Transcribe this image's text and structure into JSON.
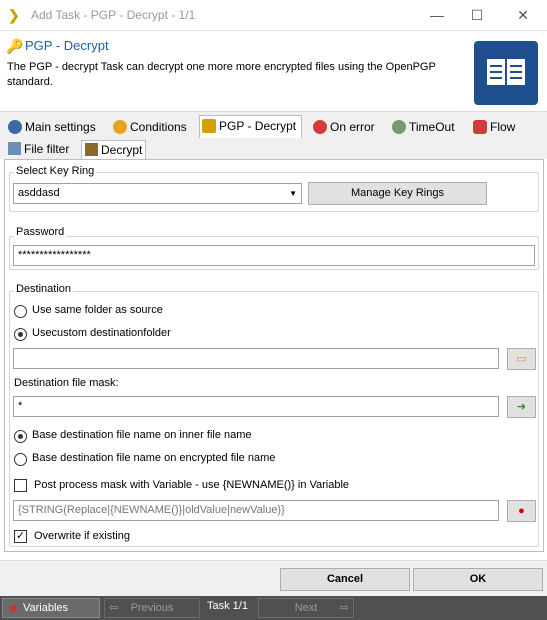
{
  "window": {
    "title": "Add Task - PGP - Decrypt - 1/1",
    "minimize": "—",
    "maximize": "☐",
    "close": "✕"
  },
  "header": {
    "title": "PGP - Decrypt",
    "description": "The PGP - decrypt Task can decrypt one more more encrypted files using the OpenPGP standard."
  },
  "tabs": [
    {
      "label": "Main settings",
      "icon": "gear-icon"
    },
    {
      "label": "Conditions",
      "icon": "conditions-icon"
    },
    {
      "label": "PGP - Decrypt",
      "icon": "key-icon"
    },
    {
      "label": "On error",
      "icon": "error-icon"
    },
    {
      "label": "TimeOut",
      "icon": "timeout-icon"
    },
    {
      "label": "Flow",
      "icon": "flow-icon"
    }
  ],
  "subtabs": [
    {
      "label": "File filter",
      "icon": "file-filter-icon"
    },
    {
      "label": "Decrypt",
      "icon": "decrypt-icon"
    }
  ],
  "keyring": {
    "group_title": "Select Key Ring",
    "selected": "asddasd",
    "manage_label": "Manage Key Rings"
  },
  "password": {
    "group_title": "Password",
    "value": "*****************"
  },
  "destination": {
    "group_title": "Destination",
    "opt_same": "Use same folder as source",
    "opt_custom": "Usecustom destinationfolder",
    "folder_value": "",
    "mask_label": "Destination file mask:",
    "mask_value": "*",
    "opt_inner": "Base destination file name on inner file name",
    "opt_encrypted": "Base destination file name on encrypted file name",
    "post_process_label": "Post process mask with Variable - use {NEWNAME()} in Variable",
    "variable_value": "{STRING(Replace|{NEWNAME()}|oldValue|newValue)}",
    "overwrite_label": "Overwrite if existing"
  },
  "footer": {
    "cancel": "Cancel",
    "ok": "OK"
  },
  "statusbar": {
    "variables": "Variables",
    "previous": "Previous",
    "task": "Task 1/1",
    "next": "Next"
  },
  "colors": {
    "accent": "#1f5fa8",
    "book": "#1f4f8f",
    "statusbar": "#505050"
  }
}
